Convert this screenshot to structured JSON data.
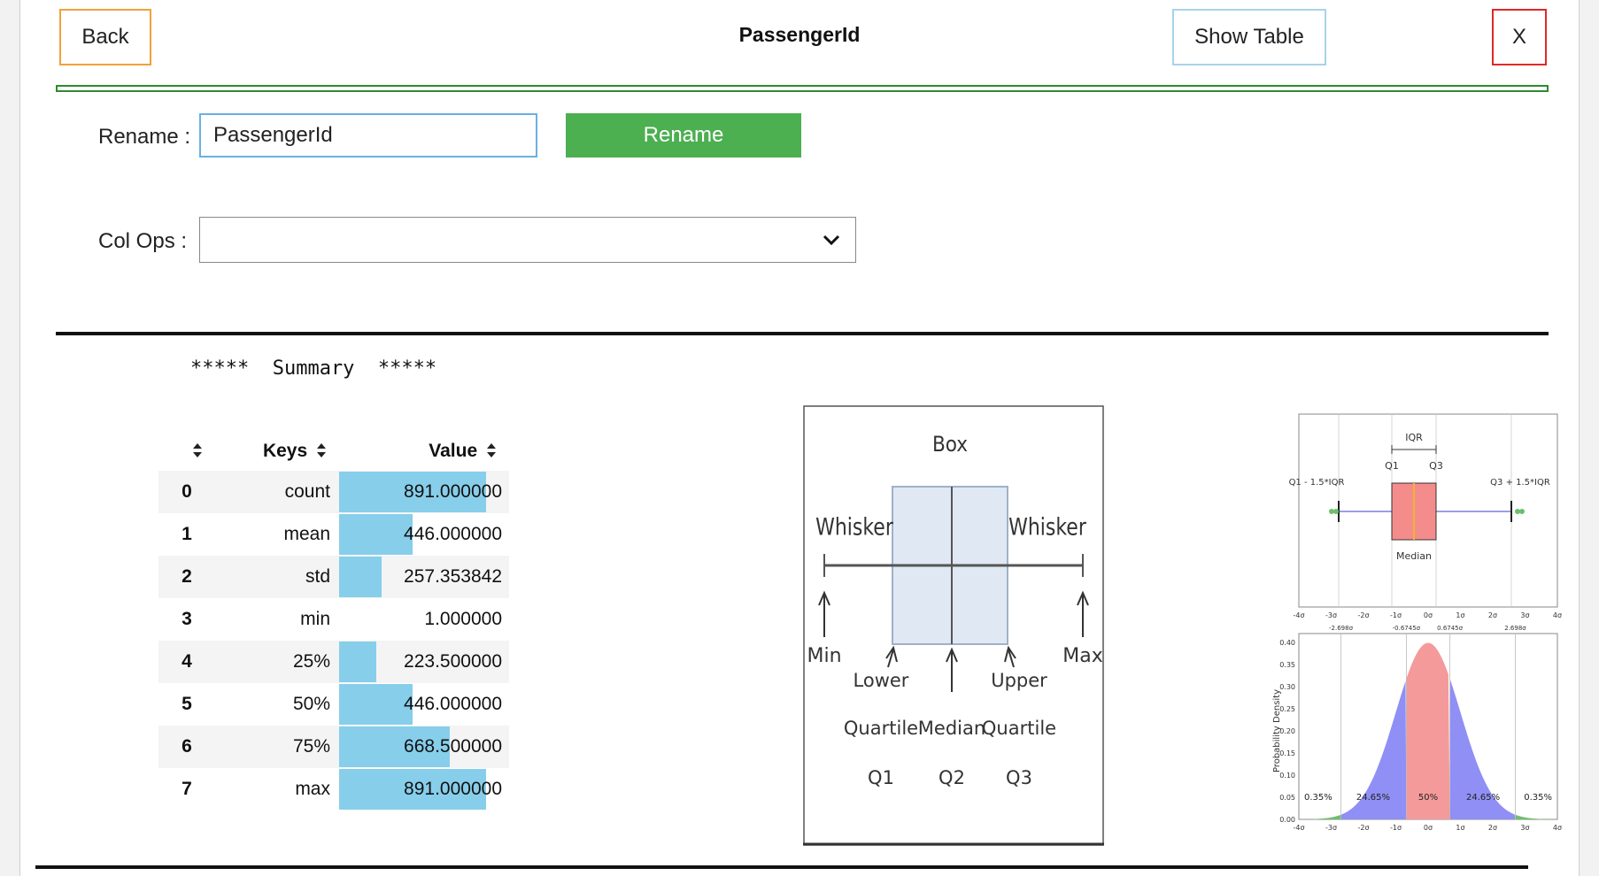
{
  "header": {
    "back_label": "Back",
    "title": "PassengerId",
    "show_table_label": "Show Table",
    "close_label": "X"
  },
  "rename": {
    "label": "Rename :",
    "value": "PassengerId",
    "button_label": "Rename"
  },
  "colops": {
    "label": "Col Ops :",
    "selected": ""
  },
  "summary_title": "*****  Summary  *****",
  "stats_table": {
    "columns": [
      "Keys",
      "Value"
    ],
    "rows": [
      {
        "index": "0",
        "key": "count",
        "value": "891.000000",
        "bar_fraction": 1.0
      },
      {
        "index": "1",
        "key": "mean",
        "value": "446.000000",
        "bar_fraction": 0.5006
      },
      {
        "index": "2",
        "key": "std",
        "value": "257.353842",
        "bar_fraction": 0.2888
      },
      {
        "index": "3",
        "key": "min",
        "value": "1.000000",
        "bar_fraction": 0.0
      },
      {
        "index": "4",
        "key": "25%",
        "value": "223.500000",
        "bar_fraction": 0.25
      },
      {
        "index": "5",
        "key": "50%",
        "value": "446.000000",
        "bar_fraction": 0.5006
      },
      {
        "index": "6",
        "key": "75%",
        "value": "668.500000",
        "bar_fraction": 0.75
      },
      {
        "index": "7",
        "key": "max",
        "value": "891.000000",
        "bar_fraction": 1.0
      }
    ]
  },
  "boxplot_figure": {
    "labels": {
      "box": "Box",
      "whisker_left": "Whisker",
      "whisker_right": "Whisker",
      "min": "Min",
      "max": "Max",
      "q1": [
        "Lower",
        "Quartile",
        "Q1"
      ],
      "q2": [
        "Median",
        "Q2"
      ],
      "q3": [
        "Upper",
        "Quartile",
        "Q3"
      ]
    }
  },
  "normal_figure": {
    "top": {
      "iqr": "IQR",
      "q1": "Q1",
      "q3": "Q3",
      "lower_fence": "Q1 - 1.5*IQR",
      "upper_fence": "Q3 + 1.5*IQR",
      "median": "Median",
      "sigma_ticks": [
        "-4σ",
        "-3σ",
        "-2σ",
        "-1σ",
        "0σ",
        "1σ",
        "2σ",
        "3σ",
        "4σ"
      ]
    },
    "bottom": {
      "ylabel": "Probability Density",
      "yticks": [
        "0.00",
        "0.05",
        "0.10",
        "0.15",
        "0.20",
        "0.25",
        "0.30",
        "0.35",
        "0.40"
      ],
      "upper_marks": [
        "-2.698σ",
        "-0.6745σ",
        "0.6745σ",
        "2.698σ"
      ],
      "pct_labels": [
        "0.35%",
        "24.65%",
        "50%",
        "24.65%",
        "0.35%"
      ],
      "sigma_ticks": [
        "-4σ",
        "-3σ",
        "-2σ",
        "-1σ",
        "0σ",
        "1σ",
        "2σ",
        "3σ",
        "4σ"
      ]
    }
  }
}
